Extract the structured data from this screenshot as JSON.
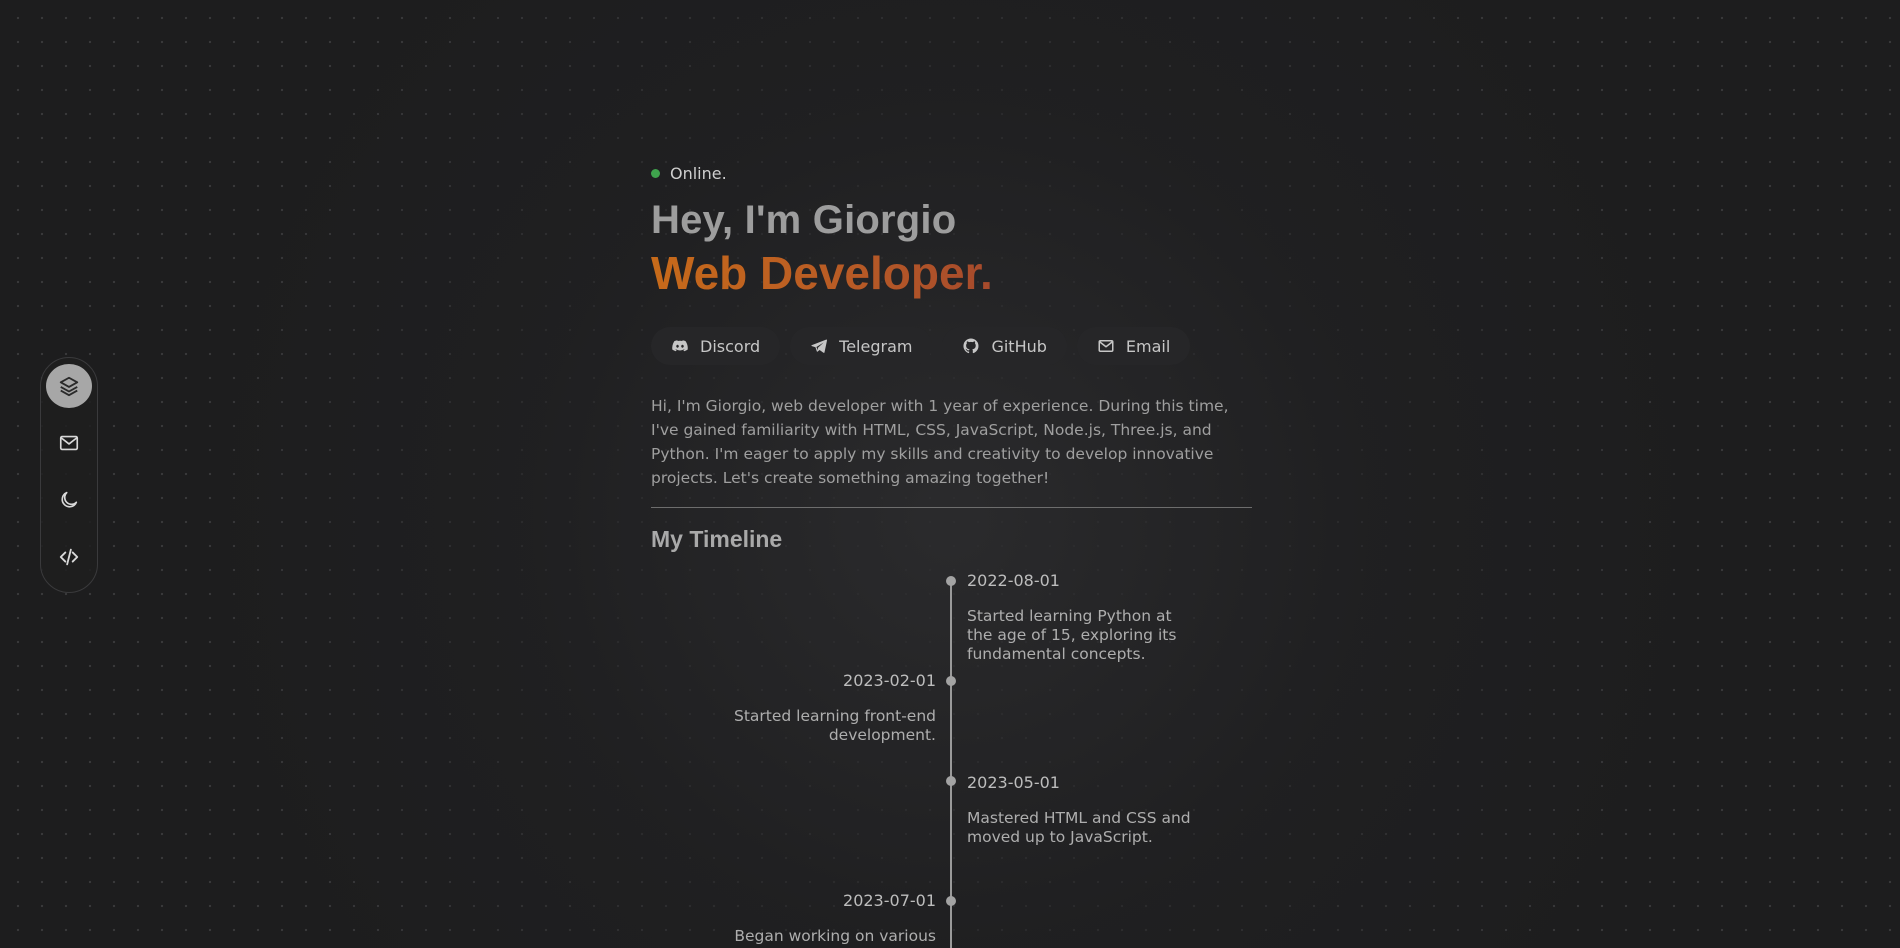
{
  "dock": {
    "items": [
      {
        "icon": "layers-icon",
        "active": true
      },
      {
        "icon": "mail-icon",
        "active": false
      },
      {
        "icon": "moon-icon",
        "active": false
      },
      {
        "icon": "code-icon",
        "active": false
      }
    ]
  },
  "status": {
    "label": "Online.",
    "color": "#3fa34d"
  },
  "hero": {
    "greeting": "Hey, I'm ",
    "name": "Giorgio",
    "role": "Web Developer."
  },
  "socials": [
    {
      "label": "Discord",
      "icon": "discord-icon"
    },
    {
      "label": "Telegram",
      "icon": "telegram-icon"
    },
    {
      "label": "GitHub",
      "icon": "github-icon"
    },
    {
      "label": "Email",
      "icon": "mail-icon"
    }
  ],
  "bio": "Hi, I'm Giorgio, web developer with 1 year of experience. During this time, I've gained familiarity with HTML, CSS, JavaScript, Node.js, Three.js, and Python. I'm eager to apply my skills and creativity to develop innovative projects. Let's create something amazing together!",
  "timeline": {
    "title": "My Timeline",
    "events": [
      {
        "date": "2022-08-01",
        "text": "Started learning Python at the age of 15, exploring its fundamental concepts.",
        "side": "right"
      },
      {
        "date": "2023-02-01",
        "text": "Started learning front-end development.",
        "side": "left"
      },
      {
        "date": "2023-05-01",
        "text": "Mastered HTML and CSS and moved up to JavaScript.",
        "side": "right"
      },
      {
        "date": "2023-07-01",
        "text": "Began working on various",
        "side": "left"
      }
    ]
  },
  "colors": {
    "accent_orange": "#c76a1a",
    "highlight_purple": "#4a3bb5",
    "background": "#1d1d1e"
  }
}
